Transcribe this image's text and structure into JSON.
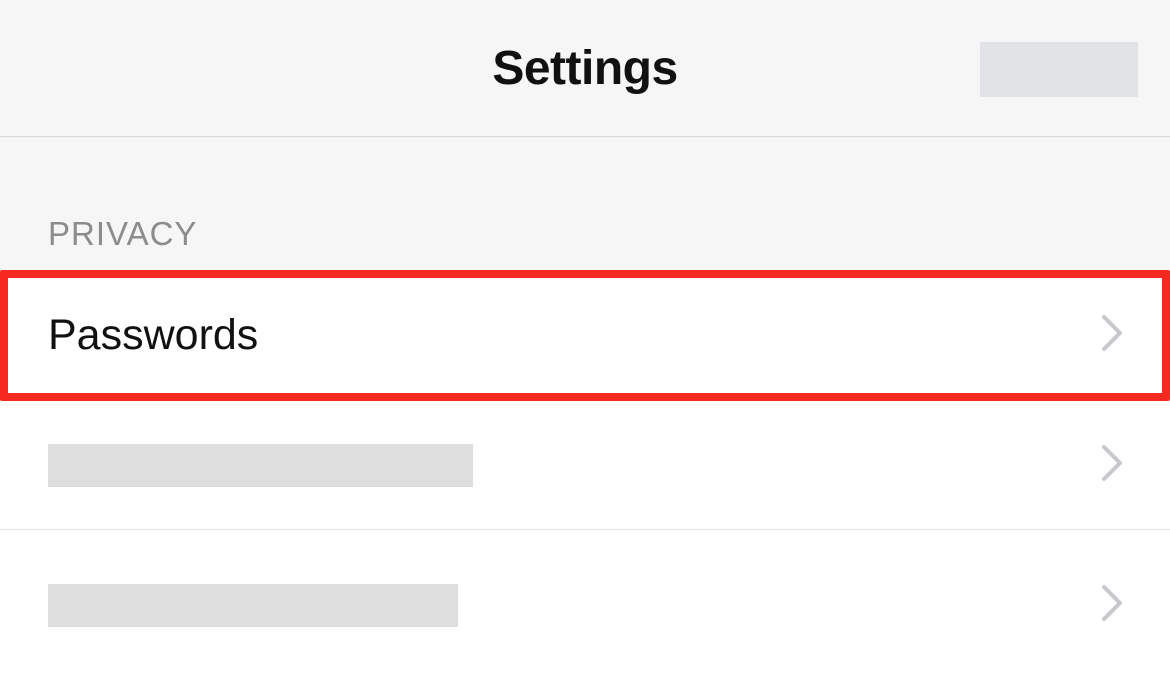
{
  "header": {
    "title": "Settings"
  },
  "section": {
    "label": "PRIVACY"
  },
  "rows": {
    "passwords": {
      "label": "Passwords"
    }
  }
}
